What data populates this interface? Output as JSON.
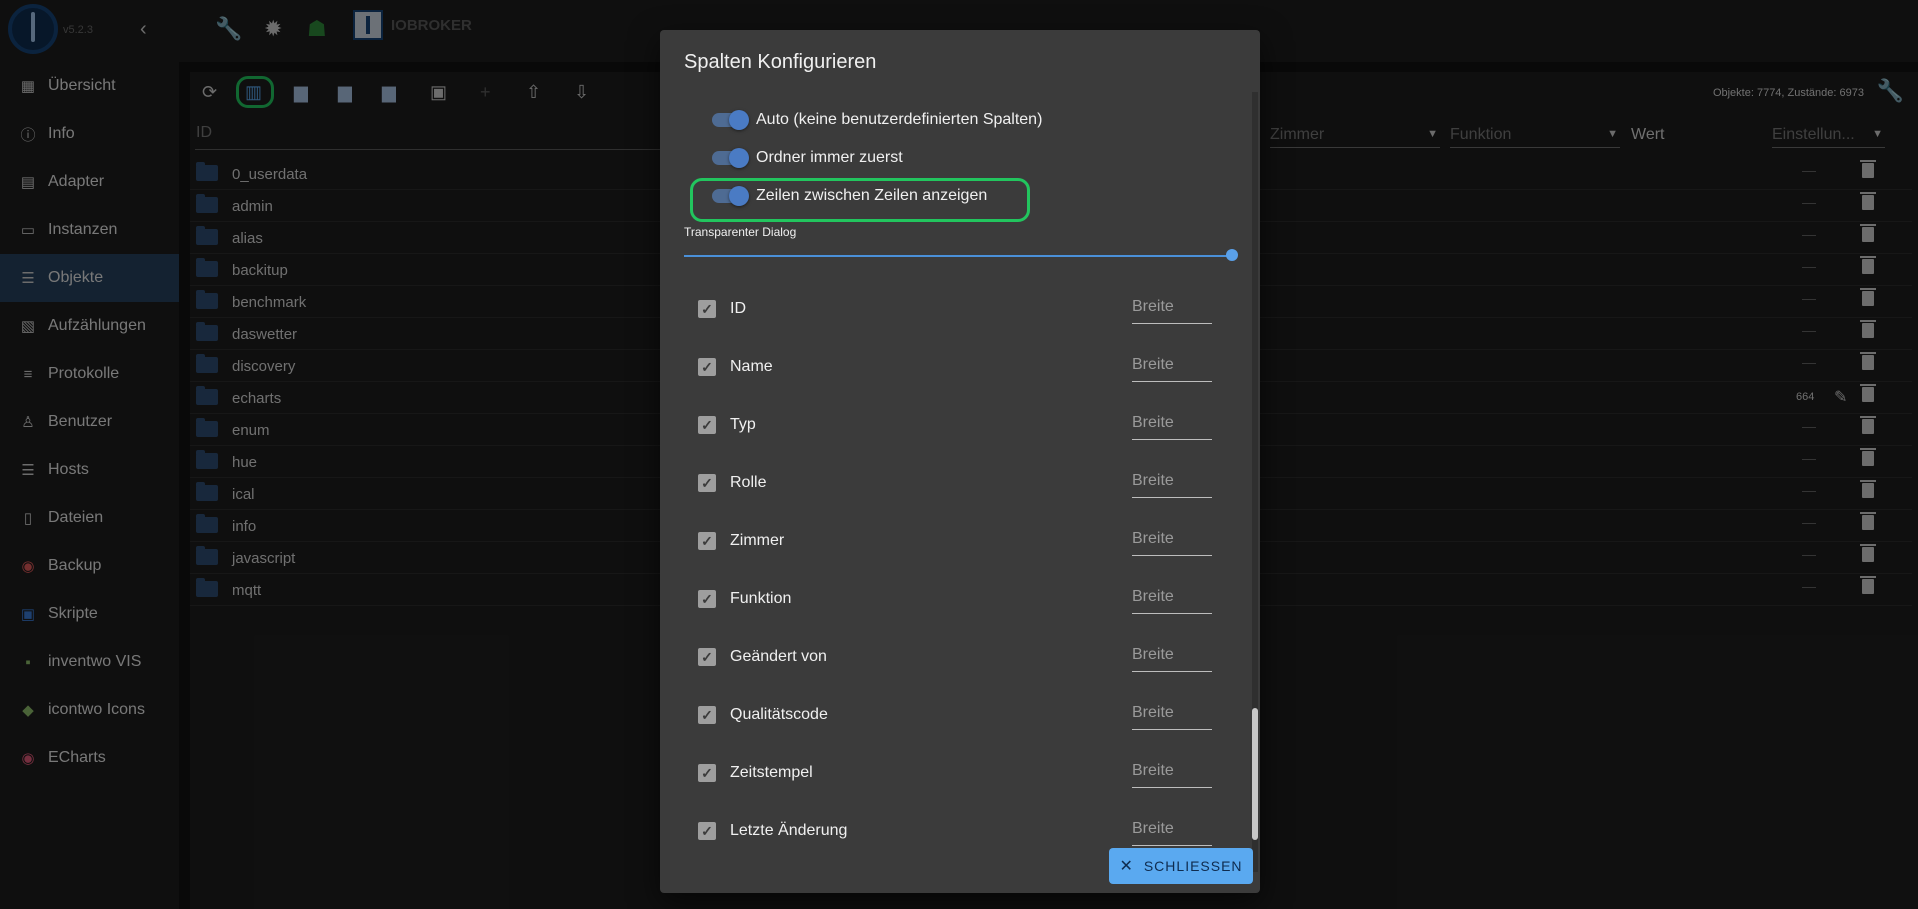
{
  "sidebar": {
    "version": "v5.2.3",
    "items": [
      {
        "label": "Übersicht",
        "icon": "grid-icon"
      },
      {
        "label": "Info",
        "icon": "info-icon"
      },
      {
        "label": "Adapter",
        "icon": "store-icon"
      },
      {
        "label": "Instanzen",
        "icon": "instances-icon"
      },
      {
        "label": "Objekte",
        "icon": "list-icon"
      },
      {
        "label": "Aufzählungen",
        "icon": "enums-icon"
      },
      {
        "label": "Protokolle",
        "icon": "logs-icon"
      },
      {
        "label": "Benutzer",
        "icon": "user-icon"
      },
      {
        "label": "Hosts",
        "icon": "hosts-icon"
      },
      {
        "label": "Dateien",
        "icon": "files-icon"
      },
      {
        "label": "Backup",
        "icon": "backup-icon"
      },
      {
        "label": "Skripte",
        "icon": "javascript-icon"
      },
      {
        "label": "inventwo VIS",
        "icon": "inventwo-icon"
      },
      {
        "label": "icontwo Icons",
        "icon": "icontwo-icon"
      },
      {
        "label": "ECharts",
        "icon": "echarts-icon"
      }
    ],
    "active": "Objekte"
  },
  "topbar": {
    "brand": "IOBROKER"
  },
  "main": {
    "stats": "Objekte: 7774, Zustände: 6973",
    "columns": {
      "id": "ID",
      "zimmer": "Zimmer",
      "funktion": "Funktion",
      "wert": "Wert",
      "einstellungen": "Einstellun..."
    },
    "rows": [
      {
        "label": "0_userdata",
        "value": "—"
      },
      {
        "label": "admin",
        "value": "—"
      },
      {
        "label": "alias",
        "value": "—"
      },
      {
        "label": "backitup",
        "value": "—"
      },
      {
        "label": "benchmark",
        "value": "—"
      },
      {
        "label": "daswetter",
        "value": "—"
      },
      {
        "label": "discovery",
        "value": "—"
      },
      {
        "label": "echarts",
        "value": "664"
      },
      {
        "label": "enum",
        "value": "—"
      },
      {
        "label": "hue",
        "value": "—"
      },
      {
        "label": "ical",
        "value": "—"
      },
      {
        "label": "info",
        "value": "—"
      },
      {
        "label": "javascript",
        "value": "—"
      },
      {
        "label": "mqtt",
        "value": "—"
      }
    ]
  },
  "dialog": {
    "title": "Spalten Konfigurieren",
    "toggles": [
      {
        "label": "Auto (keine benutzerdefinierten Spalten)",
        "on": true
      },
      {
        "label": "Ordner immer zuerst",
        "on": true
      },
      {
        "label": "Zeilen zwischen Zeilen anzeigen",
        "on": true
      }
    ],
    "slider_label": "Transparenter Dialog",
    "slider_value": 1.0,
    "width_placeholder": "Breite",
    "columns": [
      {
        "label": "ID",
        "checked": true
      },
      {
        "label": "Name",
        "checked": true
      },
      {
        "label": "Typ",
        "checked": true
      },
      {
        "label": "Rolle",
        "checked": true
      },
      {
        "label": "Zimmer",
        "checked": true
      },
      {
        "label": "Funktion",
        "checked": true
      },
      {
        "label": "Geändert von",
        "checked": true
      },
      {
        "label": "Qualitätscode",
        "checked": true
      },
      {
        "label": "Zeitstempel",
        "checked": true
      },
      {
        "label": "Letzte Änderung",
        "checked": true
      }
    ],
    "close_label": "SCHLIESSEN"
  },
  "colors": {
    "accent": "#5aa9f0",
    "highlight": "#22c55e",
    "active_nav": "#27425e"
  }
}
